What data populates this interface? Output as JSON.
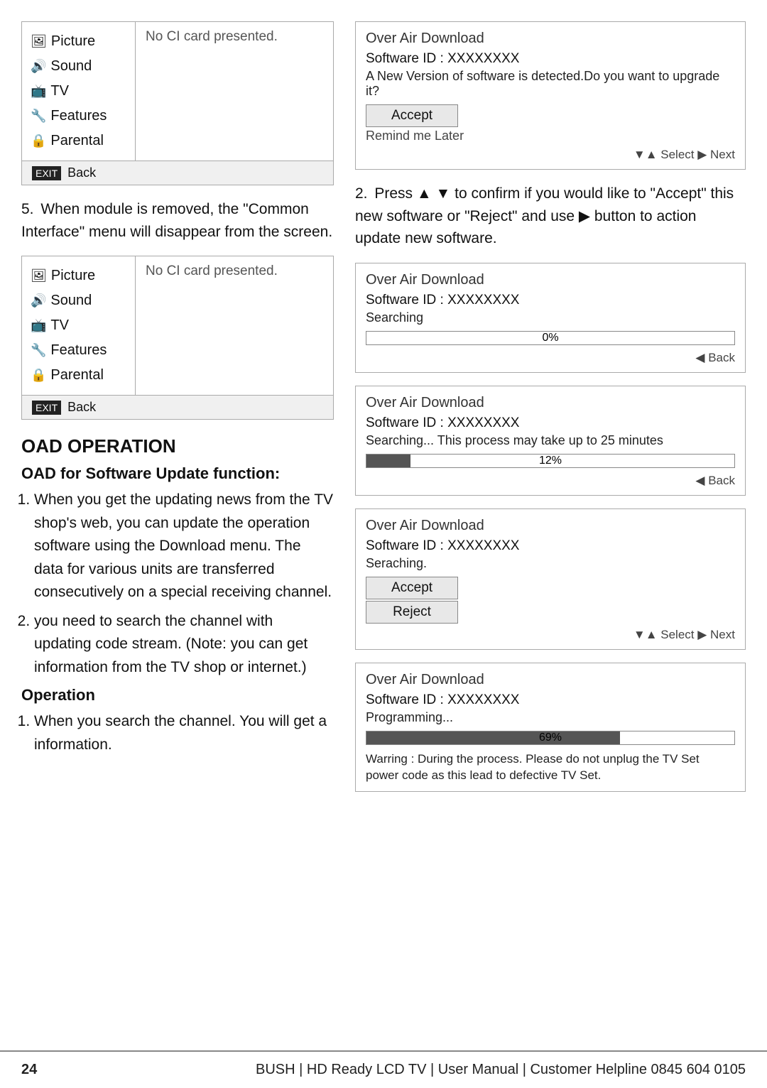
{
  "footer": {
    "page_number": "24",
    "center_text": "BUSH | HD Ready LCD TV | User Manual | Customer Helpline 0845 604 0105"
  },
  "left_col": {
    "menu_box_1": {
      "items": [
        {
          "icon": "🖼",
          "label": "Picture"
        },
        {
          "icon": "🔊",
          "label": "Sound"
        },
        {
          "icon": "📺",
          "label": "TV"
        },
        {
          "icon": "🔧",
          "label": "Features"
        },
        {
          "icon": "🔒",
          "label": "Parental"
        }
      ],
      "content": "No CI card presented.",
      "footer_label": "Back"
    },
    "step5_text": "When module is removed, the \"Common Interface\" menu will disappear from the screen.",
    "menu_box_2": {
      "items": [
        {
          "icon": "🖼",
          "label": "Picture"
        },
        {
          "icon": "🔊",
          "label": "Sound"
        },
        {
          "icon": "📺",
          "label": "TV"
        },
        {
          "icon": "🔧",
          "label": "Features"
        },
        {
          "icon": "🔒",
          "label": "Parental"
        }
      ],
      "content": "No CI card presented.",
      "footer_label": "Back"
    },
    "section_heading": "OAD OPERATION",
    "sub_heading": "OAD for Software Update function:",
    "list_items": [
      "When you get the updating news from the TV shop's web, you can update the operation software using the Download menu. The data for various units are transferred consecutively on a special receiving channel.",
      "you need to search the channel with updating code stream. (Note: you can get information from the TV shop or internet.)"
    ],
    "operation_heading": "Operation",
    "operation_list": [
      "When you search the channel. You will get a information."
    ]
  },
  "right_col": {
    "oad_box_1": {
      "title": "Over Air Download",
      "software_id": "Software ID : XXXXXXXX",
      "message": "A New Version of software is detected.Do you want to upgrade it?",
      "buttons": [
        "Accept",
        "Remind me Later"
      ],
      "nav": "▼▲ Select  ▶ Next"
    },
    "step2_text": "Press ▲ ▼ to confirm if you would like to \"Accept\" this new software or \"Reject\" and use ▶ button to action update new software.",
    "oad_box_2": {
      "title": "Over Air Download",
      "software_id": "Software ID : XXXXXXXX",
      "message": "Searching",
      "progress_percent": 0,
      "progress_label": "0%",
      "back_label": "◀ Back"
    },
    "oad_box_3": {
      "title": "Over Air Download",
      "software_id": "Software ID : XXXXXXXX",
      "message": "Searching... This process may take up to 25 minutes",
      "progress_percent": 12,
      "progress_label": "12%",
      "back_label": "◀ Back"
    },
    "oad_box_4": {
      "title": "Over Air Download",
      "software_id": "Software ID : XXXXXXXX",
      "message": "Seraching.",
      "buttons": [
        "Accept",
        "Reject"
      ],
      "nav": "▼▲ Select  ▶ Next"
    },
    "oad_box_5": {
      "title": "Over Air Download",
      "software_id": "Software ID : XXXXXXXX",
      "message": "Programming...",
      "progress_percent": 69,
      "progress_label": "69%",
      "warning": "Warring : During the process. Please do not unplug the TV Set power code as this lead to defective TV Set."
    }
  }
}
